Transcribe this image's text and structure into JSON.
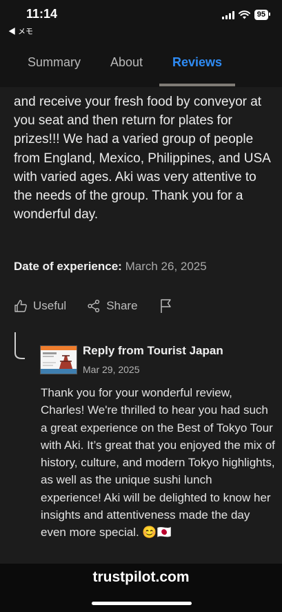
{
  "status_bar": {
    "time": "11:14",
    "back_app": "◀ メモ",
    "battery": "95"
  },
  "tabs": [
    {
      "label": "Summary",
      "active": false
    },
    {
      "label": "About",
      "active": false
    },
    {
      "label": "Reviews",
      "active": true
    }
  ],
  "review": {
    "text": "and receive your fresh food by conveyor at you seat and then return for plates for prizes!!! We had a varied group of people from England, Mexico, Philippines, and USA with varied ages. Aki was very attentive to the needs of the group. Thank you for a wonderful day.",
    "date_label": "Date of experience:",
    "date_value": "March 26, 2025"
  },
  "actions": {
    "useful": "Useful",
    "share": "Share"
  },
  "reply": {
    "title": "Reply from Tourist Japan",
    "date": "Mar 29, 2025",
    "text": "Thank you for your wonderful review, Charles! We're thrilled to hear you had such a great experience on the Best of Tokyo Tour with Aki. It’s great that you enjoyed the mix of history, culture, and modern Tokyo highlights, as well as the unique sushi lunch experience! Aki will be delighted to know her insights and attentiveness made the day even more special. 😊🇯🇵"
  },
  "footer": {
    "domain": "trustpilot.com"
  },
  "colors": {
    "accent": "#2f8cf5",
    "background": "#1c1c1c"
  }
}
